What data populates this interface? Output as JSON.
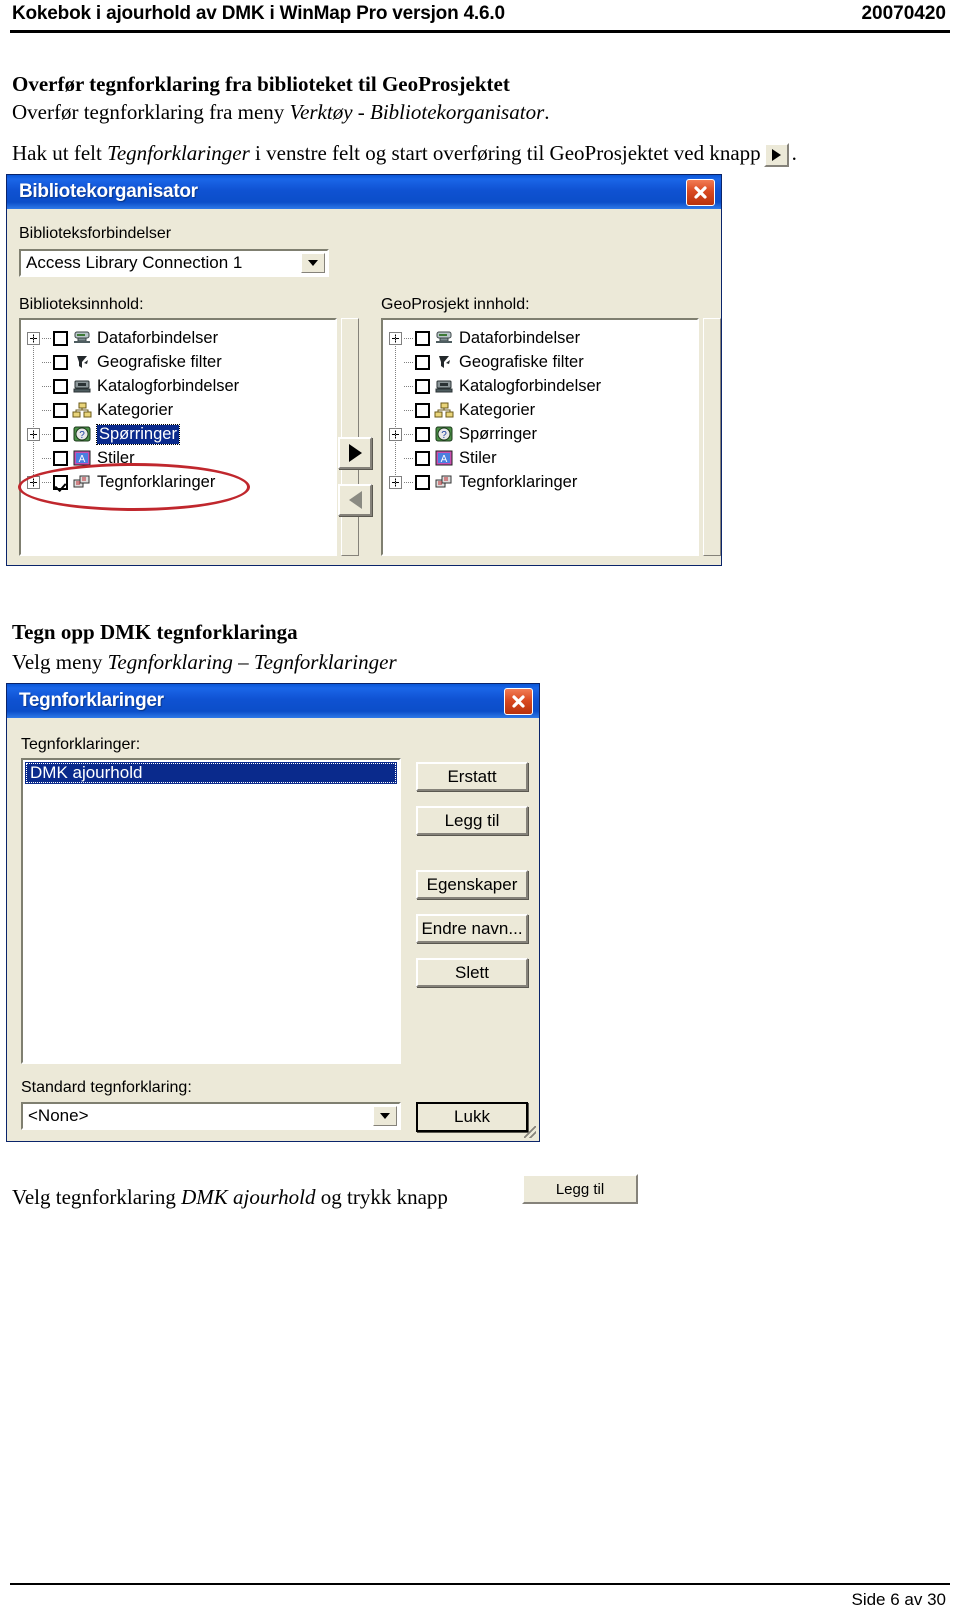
{
  "header": {
    "left": "Kokebok i ajourhold av DMK i WinMap Pro versjon 4.6.0",
    "right": "20070420"
  },
  "footer": {
    "page": "Side 6 av 30"
  },
  "section1": {
    "heading": "Overfør tegnforklaring fra biblioteket til GeoProsjektet",
    "line1_a": "Overfør tegnforklaring fra meny ",
    "line1_b": "Verktøy - Bibliotekorganisator",
    "line1_c": ".",
    "line2_a": "Hak ut felt ",
    "line2_b": "Tegnforklaringer",
    "line2_c": " i venstre felt og start overføring til GeoProsjektet ved knapp",
    "line2_d": "."
  },
  "bibliotekorganisator": {
    "title": "Bibliotekorganisator",
    "close_label": "close-icon",
    "connections_label": "Biblioteksforbindelser",
    "connections_label_u": "f",
    "connection_value": "Access Library Connection 1",
    "left_panel_label": "Biblioteksinnhold:",
    "left_panel_label_u": "B",
    "right_panel_label": "GeoProsjekt innhold:",
    "right_panel_label_u": "P",
    "left_tree": [
      {
        "label": "Dataforbindelser",
        "expander": "plus",
        "checked": false,
        "selected": false,
        "icon": "database-icon"
      },
      {
        "label": "Geografiske filter",
        "expander": "none",
        "checked": false,
        "selected": false,
        "icon": "filter-icon"
      },
      {
        "label": "Katalogforbindelser",
        "expander": "none",
        "checked": false,
        "selected": false,
        "icon": "catalog-icon"
      },
      {
        "label": "Kategorier",
        "expander": "none",
        "checked": false,
        "selected": false,
        "icon": "category-icon"
      },
      {
        "label": "Spørringer",
        "expander": "plus",
        "checked": false,
        "selected": true,
        "icon": "query-icon"
      },
      {
        "label": "Stiler",
        "expander": "none",
        "checked": false,
        "selected": false,
        "icon": "style-icon"
      },
      {
        "label": "Tegnforklaringer",
        "expander": "plus",
        "checked": true,
        "selected": false,
        "icon": "legend-icon"
      }
    ],
    "right_tree": [
      {
        "label": "Dataforbindelser",
        "expander": "plus",
        "checked": false,
        "selected": false,
        "icon": "database-icon"
      },
      {
        "label": "Geografiske filter",
        "expander": "none",
        "checked": false,
        "selected": false,
        "icon": "filter-icon"
      },
      {
        "label": "Katalogforbindelser",
        "expander": "none",
        "checked": false,
        "selected": false,
        "icon": "catalog-icon"
      },
      {
        "label": "Kategorier",
        "expander": "none",
        "checked": false,
        "selected": false,
        "icon": "category-icon"
      },
      {
        "label": "Spørringer",
        "expander": "plus",
        "checked": false,
        "selected": false,
        "icon": "query-icon"
      },
      {
        "label": "Stiler",
        "expander": "none",
        "checked": false,
        "selected": false,
        "icon": "style-icon"
      },
      {
        "label": "Tegnforklaringer",
        "expander": "plus",
        "checked": false,
        "selected": false,
        "icon": "legend-icon"
      }
    ],
    "transfer_right": "arrow-right-icon",
    "transfer_left": "arrow-left-icon"
  },
  "section2": {
    "heading": "Tegn opp DMK tegnforklaringa",
    "line1_a": "Velg meny ",
    "line1_b": "Tegnforklaring – Tegnforklaringer"
  },
  "tegnforklaringer_dialog": {
    "title": "Tegnforklaringer",
    "list_label": "Tegnforklaringer:",
    "list_label_u": "T",
    "selected_item": "DMK ajourhold",
    "buttons": [
      {
        "label": "Erstatt",
        "accel": "E",
        "name": "erstatt-button"
      },
      {
        "label": "Legg til",
        "accel": "L",
        "name": "legg-til-button"
      },
      {
        "label": "Egenskaper",
        "accel": "E",
        "name": "egenskaper-button"
      },
      {
        "label": "Endre navn...",
        "accel": "E",
        "name": "endre-navn-button"
      },
      {
        "label": "Slett",
        "accel": "S",
        "name": "slett-button"
      }
    ],
    "standard_label": "Standard tegnforklaring:",
    "standard_label_u": "S",
    "standard_value": "<None>",
    "close_button": "Lukk"
  },
  "section3": {
    "line_a": "Velg tegnforklaring ",
    "line_b": "DMK ajourhold",
    "line_c": " og trykk knapp",
    "button_label": "Legg til",
    "button_accel": "L"
  },
  "colors": {
    "titlebar_blue": "#0b4ec9",
    "dialog_face": "#ece9d8",
    "selection_blue": "#0a2a8c",
    "annotation_red": "#c0272d",
    "close_red": "#d94a22"
  }
}
